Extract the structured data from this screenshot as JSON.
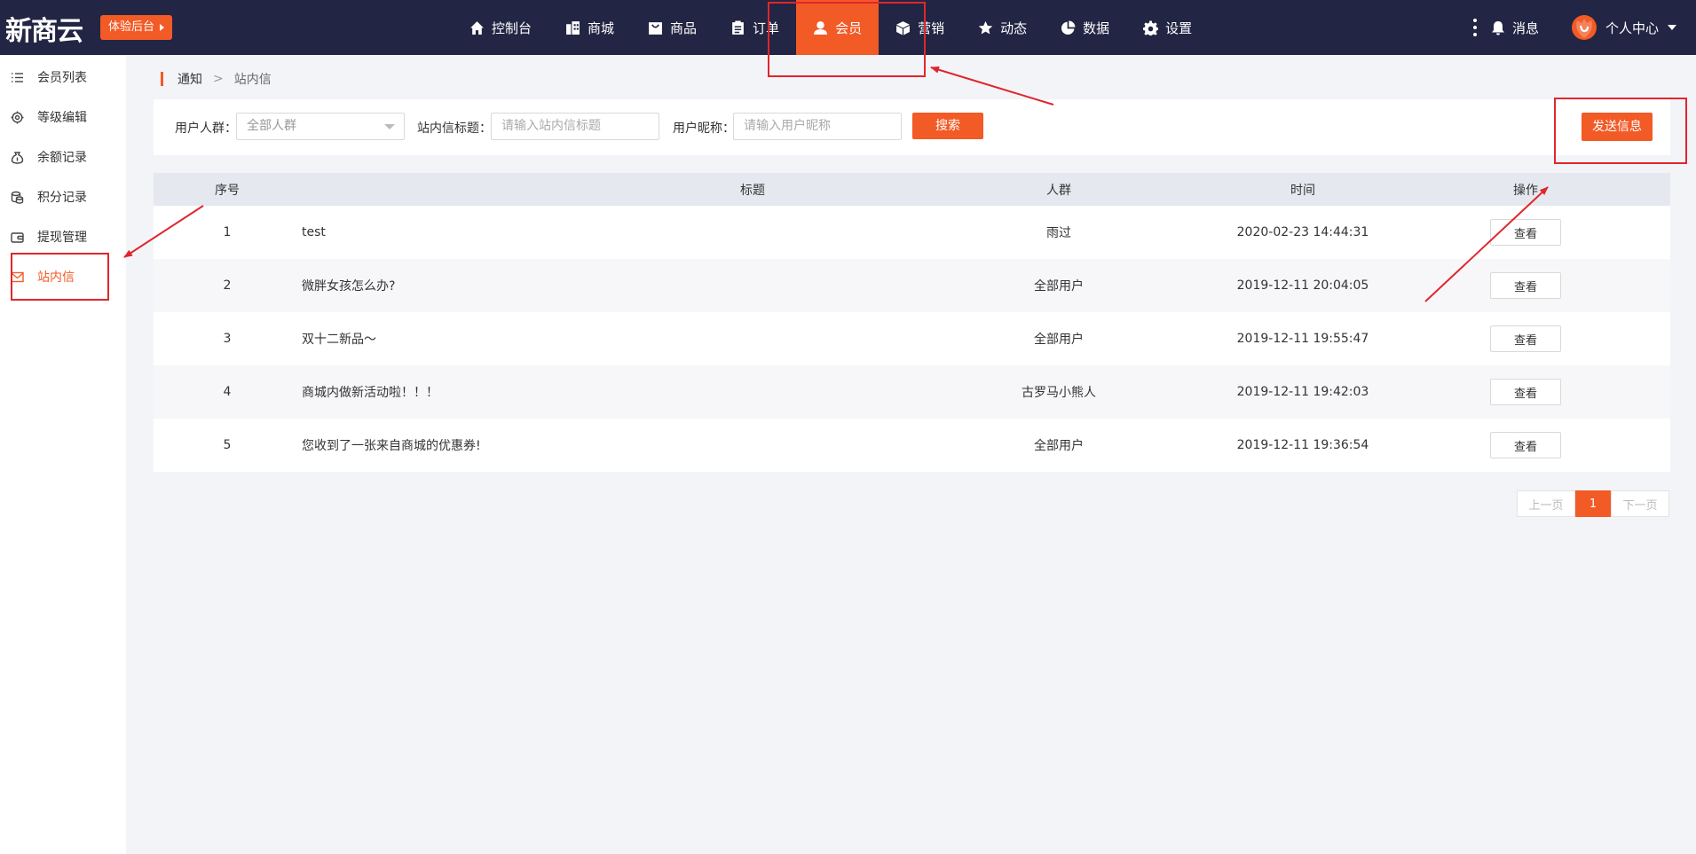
{
  "header": {
    "logo": "新商云",
    "trial_label": "体验后台",
    "nav": [
      {
        "label": "控制台",
        "icon": "home-icon"
      },
      {
        "label": "商城",
        "icon": "shop-icon"
      },
      {
        "label": "商品",
        "icon": "bag-icon"
      },
      {
        "label": "订单",
        "icon": "order-icon"
      },
      {
        "label": "会员",
        "icon": "user-icon",
        "active": true
      },
      {
        "label": "营销",
        "icon": "cube-icon"
      },
      {
        "label": "动态",
        "icon": "star-icon"
      },
      {
        "label": "数据",
        "icon": "pie-icon"
      },
      {
        "label": "设置",
        "icon": "gear-icon"
      }
    ],
    "messages_label": "消息",
    "user_label": "个人中心"
  },
  "sidebar": {
    "items": [
      {
        "label": "会员列表",
        "icon": "list-icon"
      },
      {
        "label": "等级编辑",
        "icon": "gear-icon"
      },
      {
        "label": "余额记录",
        "icon": "money-bag-icon"
      },
      {
        "label": "积分记录",
        "icon": "coins-icon"
      },
      {
        "label": "提现管理",
        "icon": "wallet-icon"
      },
      {
        "label": "站内信",
        "icon": "mail-icon",
        "active": true
      }
    ]
  },
  "breadcrumb": {
    "parent": "通知",
    "separator": ">",
    "current": "站内信"
  },
  "filters": {
    "group_label": "用户人群：",
    "group_value": "全部人群",
    "title_label": "站内信标题：",
    "title_placeholder": "请输入站内信标题",
    "nickname_label": "用户昵称：",
    "nickname_placeholder": "请输入用户昵称",
    "search_label": "搜索",
    "send_label": "发送信息"
  },
  "table": {
    "headers": {
      "index": "序号",
      "title": "标题",
      "group": "人群",
      "time": "时间",
      "action": "操作"
    },
    "rows": [
      {
        "index": "1",
        "title": "test",
        "group": "雨过",
        "time": "2020-02-23 14:44:31",
        "action": "查看"
      },
      {
        "index": "2",
        "title": "微胖女孩怎么办?",
        "group": "全部用户",
        "time": "2019-12-11 20:04:05",
        "action": "查看"
      },
      {
        "index": "3",
        "title": "双十二新品～",
        "group": "全部用户",
        "time": "2019-12-11 19:55:47",
        "action": "查看"
      },
      {
        "index": "4",
        "title": "商城内做新活动啦！！！",
        "group": "古罗马小熊人",
        "time": "2019-12-11 19:42:03",
        "action": "查看"
      },
      {
        "index": "5",
        "title": "您收到了一张来自商城的优惠券!",
        "group": "全部用户",
        "time": "2019-12-11 19:36:54",
        "action": "查看"
      }
    ]
  },
  "pagination": {
    "prev": "上一页",
    "current": "1",
    "next": "下一页"
  },
  "colors": {
    "accent": "#f25a26",
    "topbar": "#222543",
    "annotation": "#e0262d"
  }
}
